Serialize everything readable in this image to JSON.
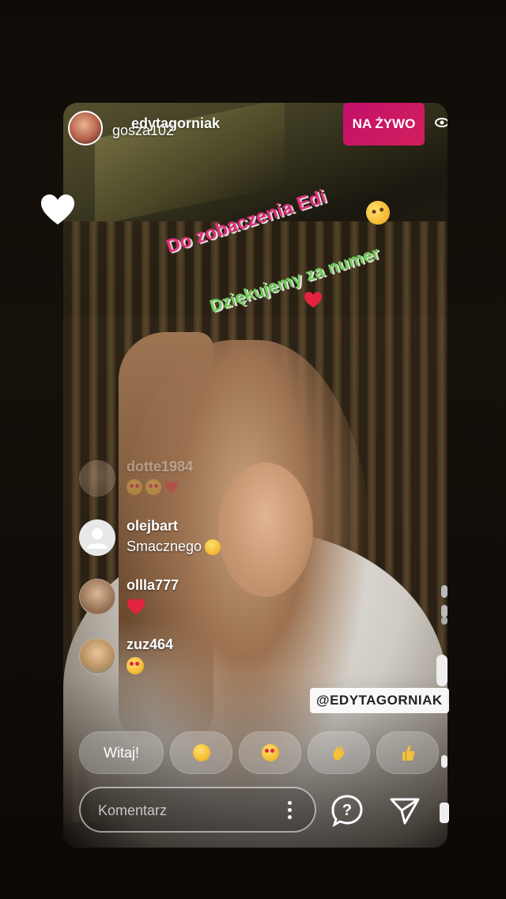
{
  "header": {
    "host_username": "edytagorniak",
    "viewer_joined": "gosza102",
    "live_label": "NA ŻYWO"
  },
  "stickers": {
    "line1": "Do zobaczenia Edi",
    "line2": "Dziękujemy za numer"
  },
  "comments": [
    {
      "username": "dotte1984",
      "text": ""
    },
    {
      "username": "olejbart",
      "text": "Smacznego"
    },
    {
      "username": "ollla777",
      "text": ""
    },
    {
      "username": "zuz464",
      "text": ""
    }
  ],
  "mention_tag": "@EDYTAGORNIAK",
  "quick_replies": [
    {
      "label": "Witaj!",
      "icon": "text"
    },
    {
      "label": "",
      "icon": "laughing-emoji-icon"
    },
    {
      "label": "",
      "icon": "heart-eyes-emoji-icon"
    },
    {
      "label": "",
      "icon": "waving-hand-icon"
    },
    {
      "label": "",
      "icon": "thumbs-up-icon"
    }
  ],
  "input": {
    "placeholder": "Komentarz"
  },
  "colors": {
    "live_badge": "#c2106b",
    "sticker_pink": "#e0307a",
    "sticker_green": "#6ccd57"
  }
}
